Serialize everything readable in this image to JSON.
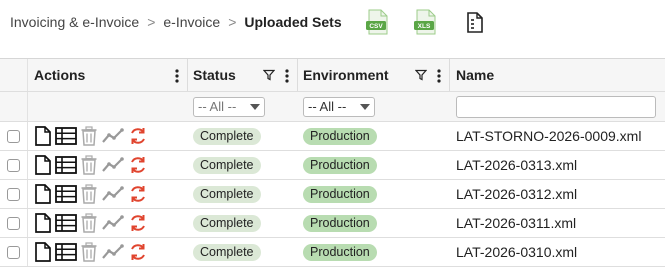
{
  "breadcrumb": {
    "items": [
      "Invoicing & e-Invoice",
      "e-Invoice"
    ],
    "current": "Uploaded Sets",
    "separator": ">"
  },
  "toolbar": {
    "csv_label": "CSV",
    "xls_label": "XLS",
    "icons": [
      "csv-file-icon",
      "xls-file-icon",
      "document-table-icon"
    ]
  },
  "grid": {
    "columns": {
      "actions": "Actions",
      "status": "Status",
      "environment": "Environment",
      "name": "Name"
    },
    "filters": {
      "status": "-- All --",
      "environment": "-- All --",
      "name": ""
    },
    "rows": [
      {
        "status": "Complete",
        "environment": "Production",
        "name": "LAT-STORNO-2026-0009.xml"
      },
      {
        "status": "Complete",
        "environment": "Production",
        "name": "LAT-2026-0313.xml"
      },
      {
        "status": "Complete",
        "environment": "Production",
        "name": "LAT-2026-0312.xml"
      },
      {
        "status": "Complete",
        "environment": "Production",
        "name": "LAT-2026-0311.xml"
      },
      {
        "status": "Complete",
        "environment": "Production",
        "name": "LAT-2026-0310.xml"
      }
    ],
    "row_action_icons": [
      "document-icon",
      "table-icon",
      "trash-icon",
      "chart-line-icon",
      "refresh-icon"
    ]
  },
  "colors": {
    "complete_badge": "#dbe8d6",
    "production_badge": "#b8dcb1",
    "refresh_icon": "#e0442e",
    "file_icon_green": "#5aa646"
  }
}
